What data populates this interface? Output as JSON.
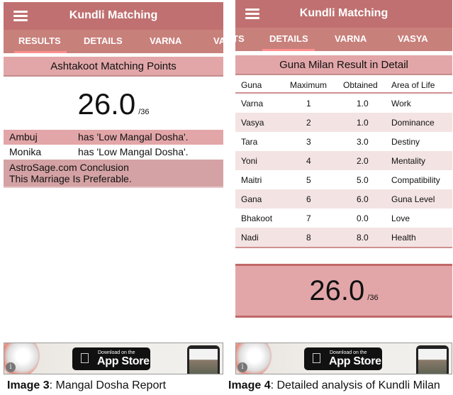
{
  "left": {
    "appbar": {
      "title": "Kundli Matching",
      "menu_icon": "hamburger-menu-icon"
    },
    "tabs": [
      {
        "label": "RESULTS",
        "active": true
      },
      {
        "label": "DETAILS",
        "active": false
      },
      {
        "label": "VARNA",
        "active": false
      },
      {
        "label": "VA",
        "active": false
      }
    ],
    "section_title": "Ashtakoot Matching Points",
    "score": {
      "value": "26.0",
      "max": "/36"
    },
    "dosha": [
      {
        "name": "Ambuj",
        "status": "has 'Low Mangal Dosha'."
      },
      {
        "name": "Monika",
        "status": "has 'Low Mangal Dosha'."
      }
    ],
    "conclusion": {
      "title": "AstroSage.com Conclusion",
      "text": "This Marriage Is Preferable."
    }
  },
  "right": {
    "appbar": {
      "title": "Kundli Matching",
      "menu_icon": "hamburger-menu-icon"
    },
    "tabs": [
      {
        "label": "TS",
        "active": false
      },
      {
        "label": "DETAILS",
        "active": true
      },
      {
        "label": "VARNA",
        "active": false
      },
      {
        "label": "VASYA",
        "active": false
      }
    ],
    "section_title": "Guna Milan Result in Detail",
    "table": {
      "headers": [
        "Guna",
        "Maximum",
        "Obtained",
        "Area of Life"
      ],
      "rows": [
        [
          "Varna",
          "1",
          "1.0",
          "Work"
        ],
        [
          "Vasya",
          "2",
          "1.0",
          "Dominance"
        ],
        [
          "Tara",
          "3",
          "3.0",
          "Destiny"
        ],
        [
          "Yoni",
          "4",
          "2.0",
          "Mentality"
        ],
        [
          "Maitri",
          "5",
          "5.0",
          "Compatibility"
        ],
        [
          "Gana",
          "6",
          "6.0",
          "Guna Level"
        ],
        [
          "Bhakoot",
          "7",
          "0.0",
          "Love"
        ],
        [
          "Nadi",
          "8",
          "8.0",
          "Health"
        ]
      ]
    },
    "score": {
      "value": "26.0",
      "max": "/36"
    }
  },
  "ad": {
    "info_icon": "info-icon",
    "apple_icon": "apple-logo-icon",
    "small_text": "Download on the",
    "big_text": "App Store"
  },
  "captions": {
    "left": {
      "bold": "Image 3",
      "text": ": Mangal Dosha Report"
    },
    "right": {
      "bold": "Image 4",
      "text": ": Detailed analysis of Kundli Milan"
    }
  },
  "colors": {
    "appbar": "#c07070",
    "tabbar": "#c8807b",
    "tab_indicator": "#ff8f8f",
    "section_head": "#e2a6a8",
    "row_alt": "#f3e3e3"
  }
}
